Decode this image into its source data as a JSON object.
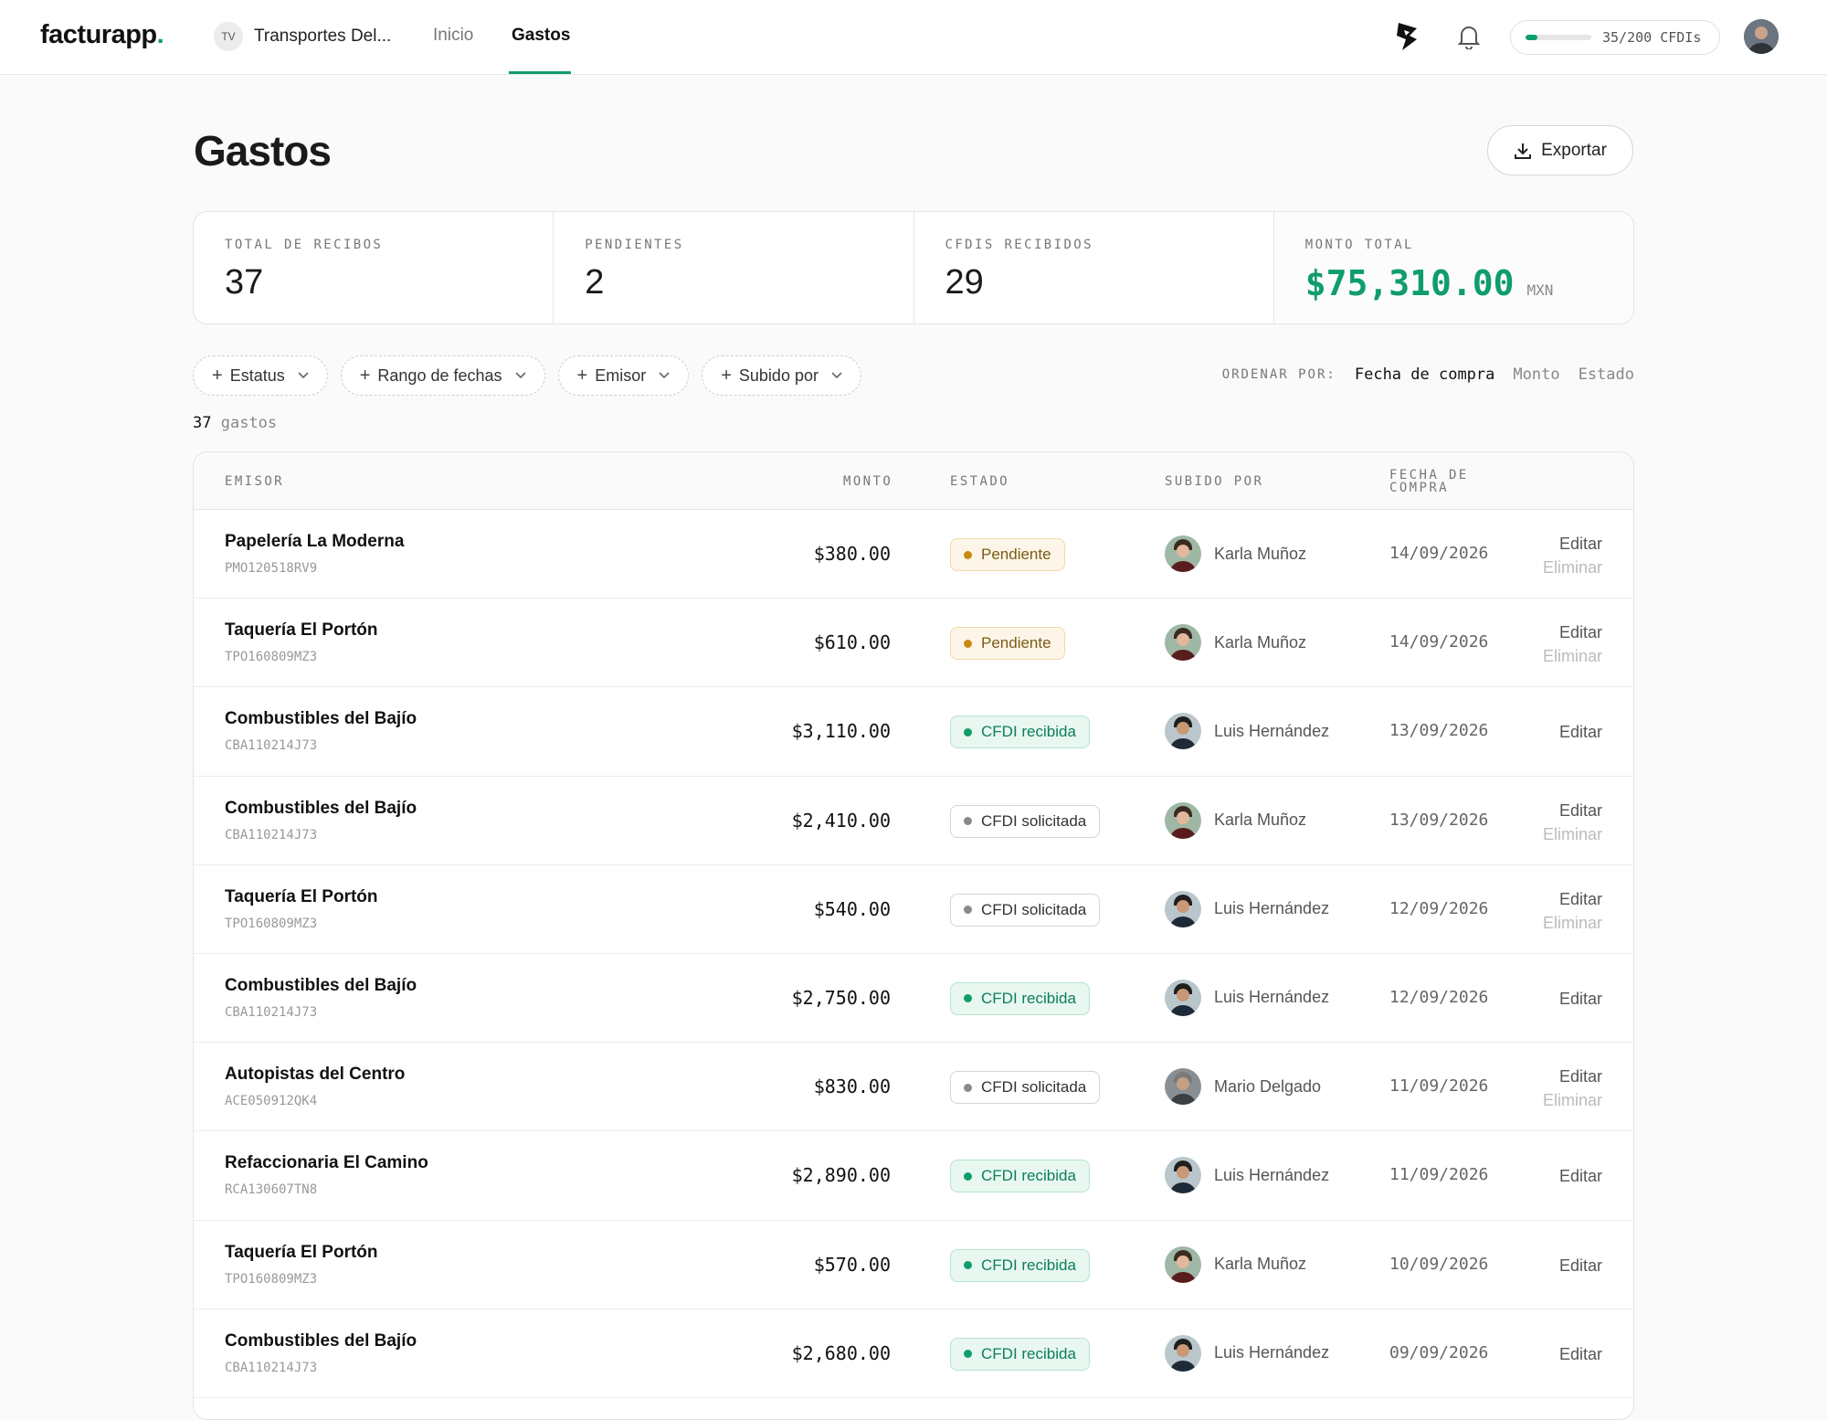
{
  "app": {
    "logo": "facturapp",
    "logo_dot": "."
  },
  "company": {
    "initials": "TV",
    "name": "Transportes Del..."
  },
  "nav": {
    "inicio": "Inicio",
    "gastos": "Gastos"
  },
  "quota": {
    "label": "35/200 CFDIs",
    "used": 35,
    "total": 200
  },
  "page": {
    "title": "Gastos",
    "export_label": "Exportar"
  },
  "stats": {
    "total_label": "TOTAL DE RECIBOS",
    "total_value": "37",
    "pending_label": "PENDIENTES",
    "pending_value": "2",
    "cfdis_label": "CFDIS RECIBIDOS",
    "cfdis_value": "29",
    "amount_label": "MONTO TOTAL",
    "amount_value": "$75,310.00",
    "amount_unit": "MXN"
  },
  "filters": {
    "estatus": "Estatus",
    "rango": "Rango de fechas",
    "emisor": "Emisor",
    "subido": "Subido por"
  },
  "sort": {
    "label": "ORDENAR POR:",
    "fecha": "Fecha de compra",
    "monto": "Monto",
    "estado": "Estado"
  },
  "count": {
    "n": "37",
    "word": "gastos"
  },
  "table": {
    "headers": {
      "emisor": "EMISOR",
      "monto": "MONTO",
      "estado": "ESTADO",
      "subido": "SUBIDO POR",
      "fecha_1": "FECHA DE",
      "fecha_2": "COMPRA"
    },
    "edit_label": "Editar",
    "delete_label": "Eliminar",
    "rows": [
      {
        "name": "Papelería La Moderna",
        "rfc": "PMO120518RV9",
        "amount": "$380.00",
        "status": "Pendiente",
        "user": "Karla Muñoz",
        "date": "14/09/2026"
      },
      {
        "name": "Taquería El Portón",
        "rfc": "TPO160809MZ3",
        "amount": "$610.00",
        "status": "Pendiente",
        "user": "Karla Muñoz",
        "date": "14/09/2026"
      },
      {
        "name": "Combustibles del Bajío",
        "rfc": "CBA110214J73",
        "amount": "$3,110.00",
        "status": "CFDI recibida",
        "user": "Luis Hernández",
        "date": "13/09/2026"
      },
      {
        "name": "Combustibles del Bajío",
        "rfc": "CBA110214J73",
        "amount": "$2,410.00",
        "status": "CFDI solicitada",
        "user": "Karla Muñoz",
        "date": "13/09/2026"
      },
      {
        "name": "Taquería El Portón",
        "rfc": "TPO160809MZ3",
        "amount": "$540.00",
        "status": "CFDI solicitada",
        "user": "Luis Hernández",
        "date": "12/09/2026"
      },
      {
        "name": "Combustibles del Bajío",
        "rfc": "CBA110214J73",
        "amount": "$2,750.00",
        "status": "CFDI recibida",
        "user": "Luis Hernández",
        "date": "12/09/2026"
      },
      {
        "name": "Autopistas del Centro",
        "rfc": "ACE050912QK4",
        "amount": "$830.00",
        "status": "CFDI solicitada",
        "user": "Mario Delgado",
        "date": "11/09/2026"
      },
      {
        "name": "Refaccionaria El Camino",
        "rfc": "RCA130607TN8",
        "amount": "$2,890.00",
        "status": "CFDI recibida",
        "user": "Luis Hernández",
        "date": "11/09/2026"
      },
      {
        "name": "Taquería El Portón",
        "rfc": "TPO160809MZ3",
        "amount": "$570.00",
        "status": "CFDI recibida",
        "user": "Karla Muñoz",
        "date": "10/09/2026"
      },
      {
        "name": "Combustibles del Bajío",
        "rfc": "CBA110214J73",
        "amount": "$2,680.00",
        "status": "CFDI recibida",
        "user": "Luis Hernández",
        "date": "09/09/2026"
      }
    ]
  },
  "colors": {
    "accent": "#0f9d6b",
    "pending": "#c98a12",
    "requested": "#8a8a8a"
  }
}
